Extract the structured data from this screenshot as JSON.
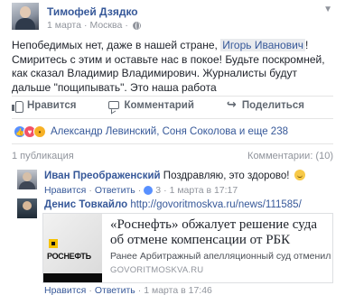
{
  "post": {
    "author": "Тимофей Дзядко",
    "date": "1 марта",
    "location": "Москва",
    "text_before": "Непобедимых нет, даже в нашей стране, ",
    "mention": "Игорь Иванович",
    "text_after": "! Смиритесь с этим и оставьте нас в покое! Будьте поскромней, как сказал Владимир Владимирович. Журналисты будут дальше \"пощипывать\". Это наша работа"
  },
  "actions": {
    "like": "Нравится",
    "comment": "Комментарий",
    "share": "Поделиться"
  },
  "reactions": {
    "summary": "Александр Левинский, Соня Соколова и еще 238"
  },
  "stats": {
    "shares": "1 публикация",
    "comments": "Комментарии: (10)"
  },
  "comments": [
    {
      "author": "Иван Преображенский",
      "text": "Поздравляю, это здорово!",
      "like": "Нравится",
      "reply": "Ответить",
      "likes": "3",
      "time": "1 марта в 17:17"
    },
    {
      "author": "Денис Товкайло",
      "link": "http://govoritmoskva.ru/news/111585/",
      "like": "Нравится",
      "reply": "Ответить",
      "time": "1 марта в 17:46"
    }
  ],
  "preview": {
    "title": "«Роснефть» обжалует решение суда об отмене компенсации от РБК",
    "description": "Ранее Арбитражный апелляционный суд отменил...",
    "domain": "GOVORITMOSKVA.RU",
    "logo_text": "РОСНЕФТЬ"
  },
  "colors": {
    "link": "#365899",
    "muted": "#90949c",
    "like_blue": "#5890ff"
  }
}
